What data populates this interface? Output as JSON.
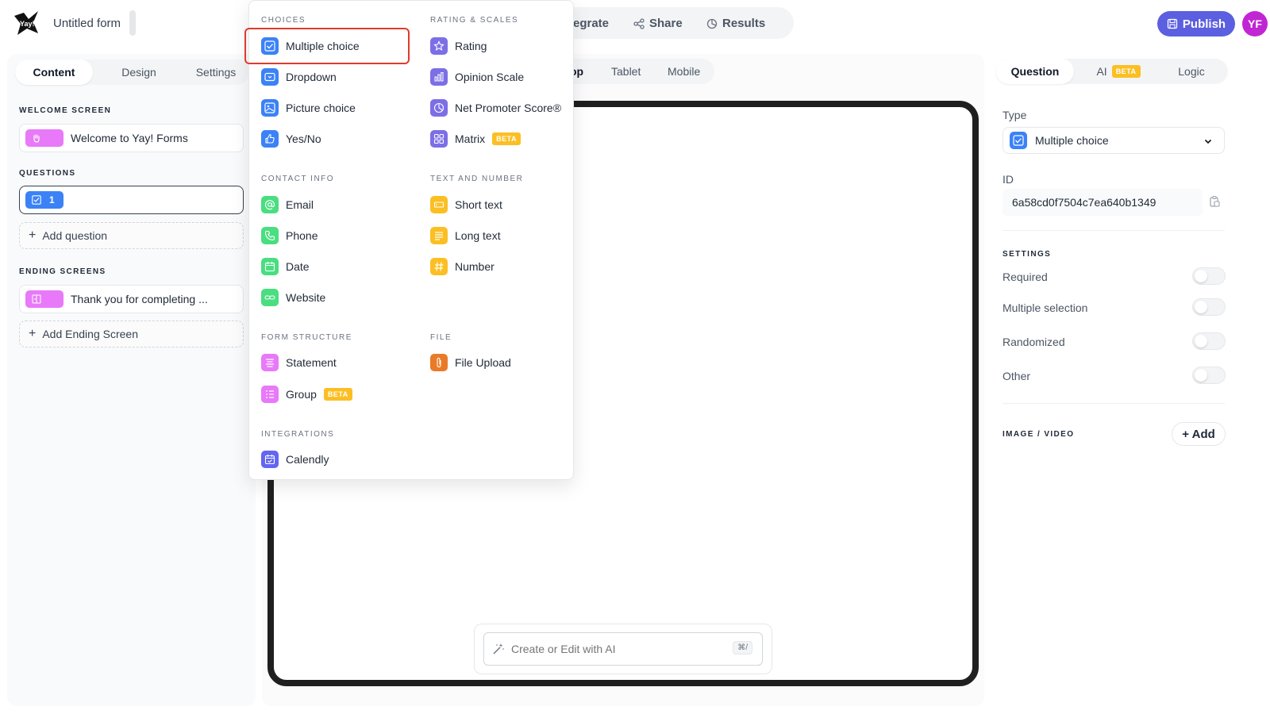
{
  "header": {
    "form_title": "Untitled form",
    "nav": [
      {
        "label": "egrate",
        "icon": "integrate-icon"
      },
      {
        "label": "Share",
        "icon": "share-icon"
      },
      {
        "label": "Results",
        "icon": "results-icon"
      }
    ],
    "publish_label": "Publish",
    "avatar_initials": "YF",
    "logo_text": "Yay!"
  },
  "left": {
    "tabs": [
      "Content",
      "Design",
      "Settings"
    ],
    "active_tab": "Content",
    "welcome_label": "WELCOME SCREEN",
    "welcome_item": "Welcome to Yay! Forms",
    "questions_label": "QUESTIONS",
    "question_number": "1",
    "add_question": "Add question",
    "ending_label": "ENDING SCREENS",
    "ending_item": "Thank you for completing ...",
    "add_ending": "Add Ending Screen"
  },
  "center": {
    "device_tabs": [
      "op",
      "Tablet",
      "Mobile"
    ],
    "ai_placeholder": "Create or Edit with AI",
    "ai_shortcut": "⌘/"
  },
  "menu": {
    "choices_head": "CHOICES",
    "choices": [
      "Multiple choice",
      "Dropdown",
      "Picture choice",
      "Yes/No"
    ],
    "rating_head": "RATING & SCALES",
    "rating": [
      "Rating",
      "Opinion Scale",
      "Net Promoter Score®",
      "Matrix"
    ],
    "contact_head": "CONTACT INFO",
    "contact": [
      "Email",
      "Phone",
      "Date",
      "Website"
    ],
    "text_head": "TEXT AND NUMBER",
    "text": [
      "Short text",
      "Long text",
      "Number"
    ],
    "structure_head": "FORM STRUCTURE",
    "structure": [
      "Statement",
      "Group"
    ],
    "file_head": "FILE",
    "file": [
      "File Upload"
    ],
    "integrations_head": "INTEGRATIONS",
    "integrations": [
      "Calendly"
    ],
    "beta_label": "BETA"
  },
  "right": {
    "tabs": [
      "Question",
      "AI",
      "Logic"
    ],
    "active_tab": "Question",
    "ai_badge": "BETA",
    "type_label": "Type",
    "type_value": "Multiple choice",
    "id_label": "ID",
    "id_value": "6a58cd0f7504c7ea640b1349",
    "settings_label": "SETTINGS",
    "settings": [
      {
        "label": "Required",
        "on": false
      },
      {
        "label": "Multiple selection",
        "on": false
      },
      {
        "label": "Randomized",
        "on": false
      },
      {
        "label": "Other",
        "on": false
      }
    ],
    "media_label": "IMAGE / VIDEO",
    "add_media": "+ Add"
  },
  "colors": {
    "accent": "#5b5fe0",
    "avatar": "#c026d3",
    "highlight": "#e03b2c",
    "beta": "#fbbf24"
  }
}
